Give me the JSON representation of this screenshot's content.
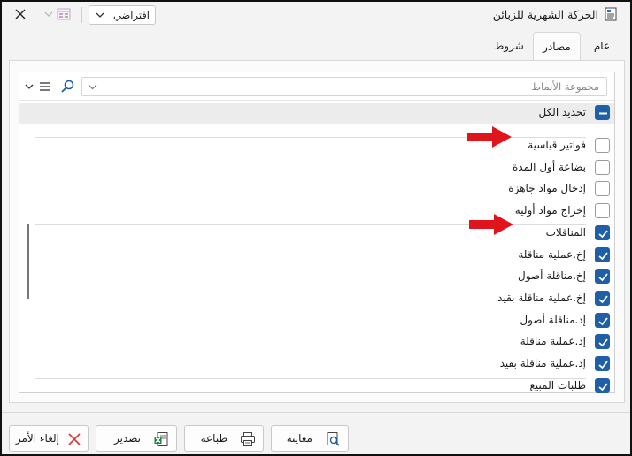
{
  "window": {
    "title": "الحركة الشهرية للزبائن",
    "profile_combo_value": "افتراضي"
  },
  "tabs": [
    {
      "label": "عام",
      "active": false
    },
    {
      "label": "مصادر",
      "active": true
    },
    {
      "label": "شروط",
      "active": false
    }
  ],
  "filter": {
    "placeholder": "مجموعة الأنماط"
  },
  "select_all": {
    "label": "تحديد الكل",
    "state": "indeterminate"
  },
  "items": [
    {
      "label": "فواتير قياسية",
      "checked": false
    },
    {
      "label": "بضاعة أول المدة",
      "checked": false
    },
    {
      "label": "إدخال مواد جاهزة",
      "checked": false
    },
    {
      "label": "إخراج مواد أولية",
      "checked": false
    },
    {
      "label": "المناقلات",
      "checked": true
    },
    {
      "label": "إخ.عملية مناقلة",
      "checked": true
    },
    {
      "label": "إخ.مناقلة أصول",
      "checked": true
    },
    {
      "label": "إخ.عملية مناقلة بقيد",
      "checked": true
    },
    {
      "label": "إد.مناقلة أصول",
      "checked": true
    },
    {
      "label": "إد.عملية مناقلة",
      "checked": true
    },
    {
      "label": "إد.عملية مناقلة بقيد",
      "checked": true
    },
    {
      "label": "طلبات المبيع",
      "checked": true
    }
  ],
  "footer": {
    "preview_label": "معاينة",
    "print_label": "طباعة",
    "export_label": "تصدير",
    "cancel_label": "إلغاء الأمر"
  },
  "colors": {
    "accent": "#1e5fa8",
    "arrow_red": "#e0141b"
  }
}
